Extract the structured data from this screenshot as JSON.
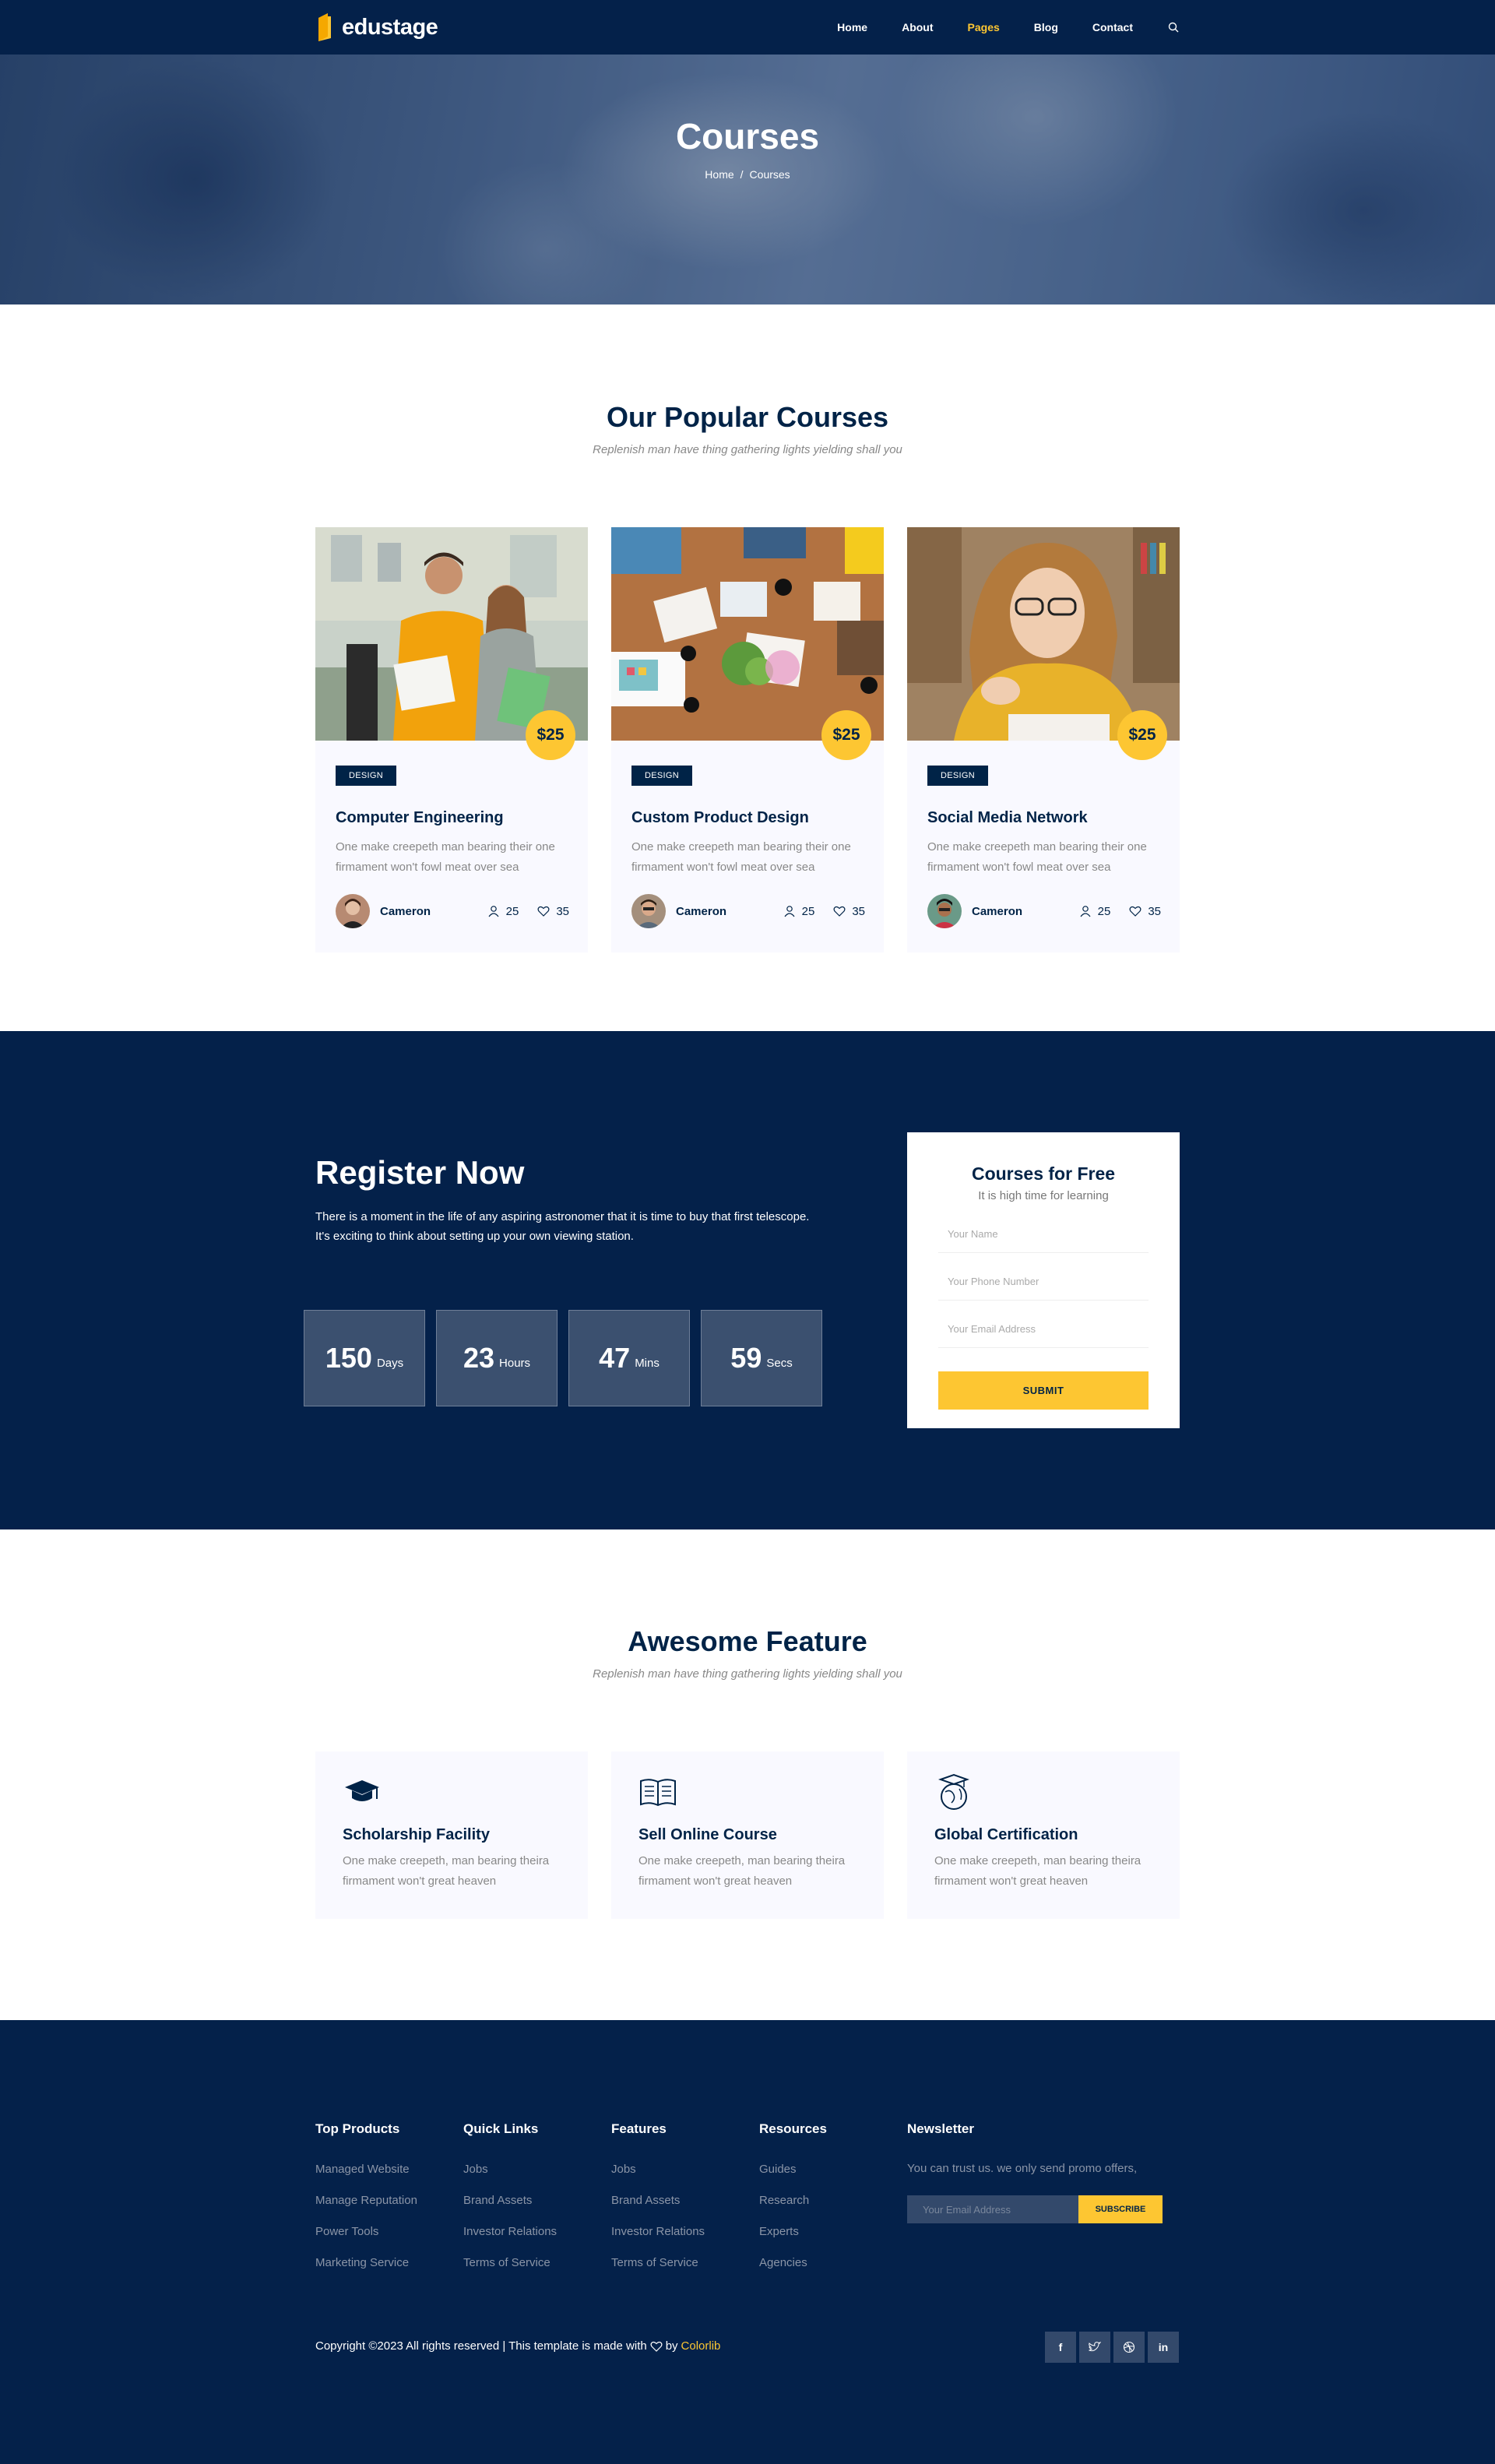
{
  "header": {
    "brand": "edustage",
    "nav": [
      "Home",
      "About",
      "Pages",
      "Blog",
      "Contact"
    ],
    "active_nav": "Pages"
  },
  "banner": {
    "title": "Courses",
    "breadcrumb": [
      "Home",
      "/",
      "Courses"
    ]
  },
  "courses_section": {
    "title": "Our Popular Courses",
    "subtitle": "Replenish man have thing gathering lights yielding shall you",
    "cards": [
      {
        "price": "$25",
        "tag": "DESIGN",
        "title": "Computer Engineering",
        "desc": "One make creepeth man bearing their one firmament won't fowl meat over sea",
        "author": "Cameron",
        "students": "25",
        "likes": "35"
      },
      {
        "price": "$25",
        "tag": "DESIGN",
        "title": "Custom Product Design",
        "desc": "One make creepeth man bearing their one firmament won't fowl meat over sea",
        "author": "Cameron",
        "students": "25",
        "likes": "35"
      },
      {
        "price": "$25",
        "tag": "DESIGN",
        "title": "Social Media Network",
        "desc": "One make creepeth man bearing their one firmament won't fowl meat over sea",
        "author": "Cameron",
        "students": "25",
        "likes": "35"
      }
    ]
  },
  "register": {
    "title": "Register Now",
    "text": "There is a moment in the life of any aspiring astronomer that it is time to buy that first telescope. It's exciting to think about setting up your own viewing station.",
    "countdown": [
      {
        "value": "150",
        "unit": "Days"
      },
      {
        "value": "23",
        "unit": "Hours"
      },
      {
        "value": "47",
        "unit": "Mins"
      },
      {
        "value": "59",
        "unit": "Secs"
      }
    ],
    "form": {
      "title": "Courses for Free",
      "subtitle": "It is high time for learning",
      "placeholders": [
        "Your Name",
        "Your Phone Number",
        "Your Email Address"
      ],
      "submit": "SUBMIT"
    }
  },
  "features_section": {
    "title": "Awesome Feature",
    "subtitle": "Replenish man have thing gathering lights yielding shall you",
    "cards": [
      {
        "icon": "graduation-cap-icon",
        "title": "Scholarship Facility",
        "desc": "One make creepeth, man bearing theira firmament won't great heaven"
      },
      {
        "icon": "open-book-icon",
        "title": "Sell Online Course",
        "desc": "One make creepeth, man bearing theira firmament won't great heaven"
      },
      {
        "icon": "globe-graduate-icon",
        "title": "Global Certification",
        "desc": "One make creepeth, man bearing theira firmament won't great heaven"
      }
    ]
  },
  "footer": {
    "columns": [
      {
        "title": "Top Products",
        "links": [
          "Managed Website",
          "Manage Reputation",
          "Power Tools",
          "Marketing Service"
        ]
      },
      {
        "title": "Quick Links",
        "links": [
          "Jobs",
          "Brand Assets",
          "Investor Relations",
          "Terms of Service"
        ]
      },
      {
        "title": "Features",
        "links": [
          "Jobs",
          "Brand Assets",
          "Investor Relations",
          "Terms of Service"
        ]
      },
      {
        "title": "Resources",
        "links": [
          "Guides",
          "Research",
          "Experts",
          "Agencies"
        ]
      }
    ],
    "newsletter": {
      "title": "Newsletter",
      "text": "You can trust us. we only send promo offers,",
      "placeholder": "Your Email Address",
      "button": "SUBSCRIBE"
    },
    "copyright_prefix": "Copyright ©2023 All rights reserved | This template is made with",
    "copyright_by": "by",
    "copyright_brand": "Colorlib",
    "socials": [
      "facebook-icon",
      "twitter-icon",
      "dribbble-icon",
      "linkedin-icon"
    ]
  },
  "colors": {
    "navy": "#04214a",
    "accent": "#fdc632",
    "card_bg": "#f9f9ff"
  }
}
